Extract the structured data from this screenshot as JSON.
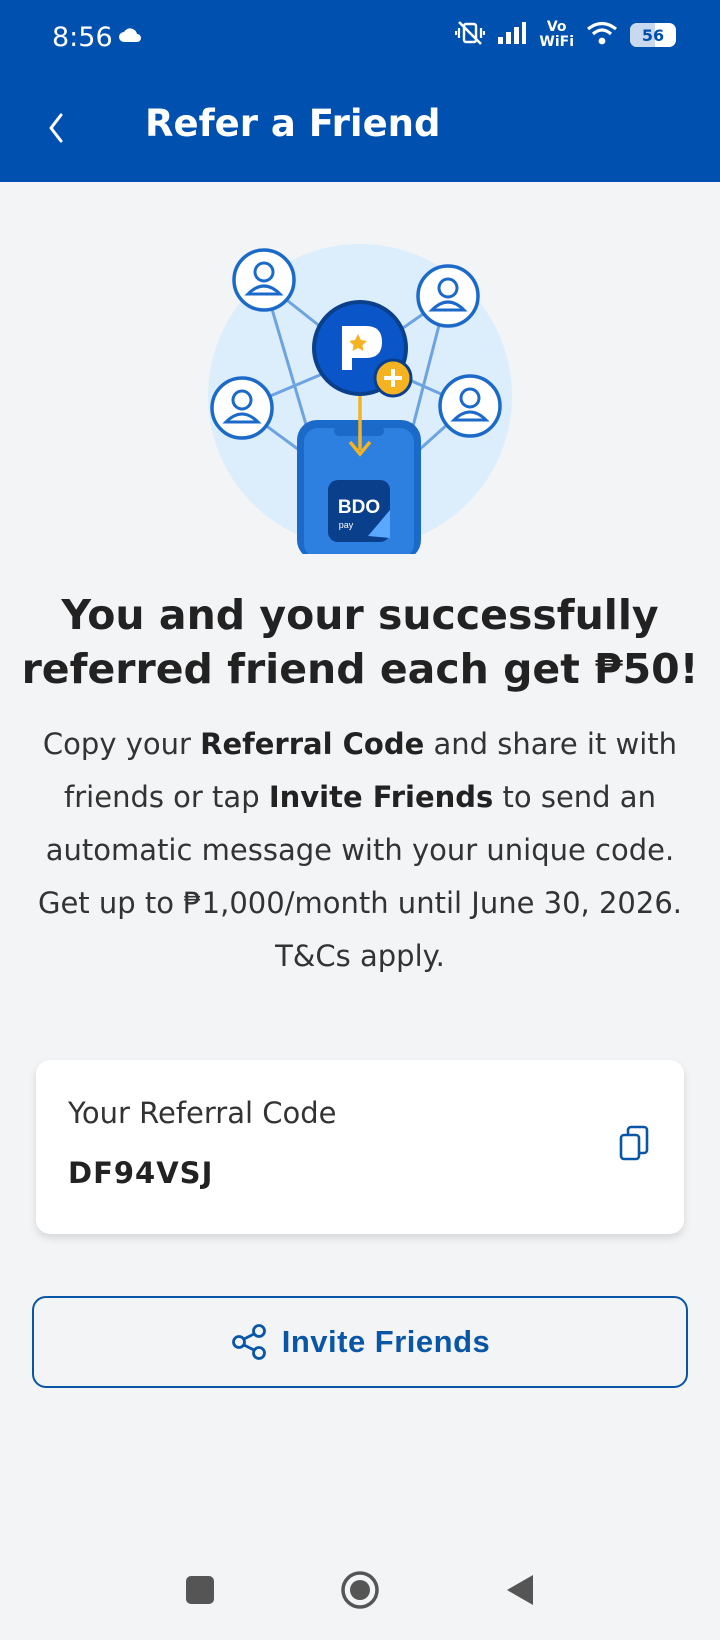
{
  "status_bar": {
    "time": "8:56",
    "network_label_top": "Vo",
    "network_label_bottom": "WiFi",
    "battery": "56"
  },
  "header": {
    "title": "Refer a Friend"
  },
  "hero": {
    "wallet_brand": "BDO",
    "wallet_sub": "pay",
    "accent_color": "#0050b0",
    "badge_color": "#f5b321"
  },
  "headline": {
    "line1": "You and your successfully",
    "line2": "referred friend each get ₱50!"
  },
  "description": {
    "part1": "Copy your ",
    "bold1": "Referral Code",
    "part2": " and share it with friends or tap ",
    "bold2": "Invite Friends",
    "part3": " to send an automatic message with your unique code. Get up to ₱1,000/month until June 30, 2026. T&Cs apply."
  },
  "referral": {
    "label": "Your Referral Code",
    "code": "DF94VSJ",
    "copy_icon": "copy-icon"
  },
  "invite": {
    "label": "Invite Friends",
    "icon": "share-icon"
  },
  "nav": {
    "items": [
      "recents",
      "home",
      "back"
    ]
  }
}
